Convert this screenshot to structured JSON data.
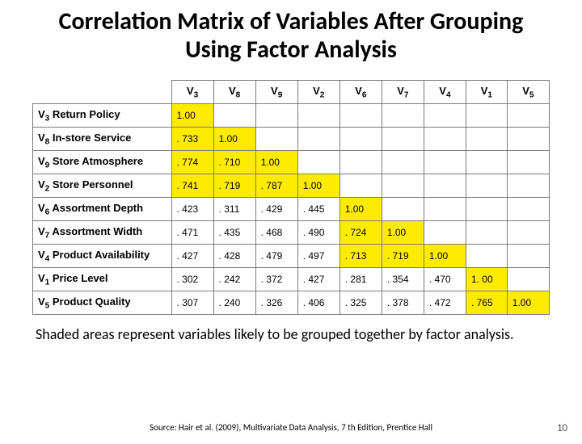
{
  "title": "Correlation Matrix of Variables After Grouping Using Factor Analysis",
  "columns": [
    {
      "sym": "V",
      "sub": "3"
    },
    {
      "sym": "V",
      "sub": "8"
    },
    {
      "sym": "V",
      "sub": "9"
    },
    {
      "sym": "V",
      "sub": "2"
    },
    {
      "sym": "V",
      "sub": "6"
    },
    {
      "sym": "V",
      "sub": "7"
    },
    {
      "sym": "V",
      "sub": "4"
    },
    {
      "sym": "V",
      "sub": "1"
    },
    {
      "sym": "V",
      "sub": "5"
    }
  ],
  "rows": [
    {
      "sym": "V",
      "sub": "3",
      "name": "Return Policy"
    },
    {
      "sym": "V",
      "sub": "8",
      "name": "In-store Service"
    },
    {
      "sym": "V",
      "sub": "9",
      "name": "Store Atmosphere"
    },
    {
      "sym": "V",
      "sub": "2",
      "name": "Store Personnel"
    },
    {
      "sym": "V",
      "sub": "6",
      "name": "Assortment Depth"
    },
    {
      "sym": "V",
      "sub": "7",
      "name": "Assortment Width"
    },
    {
      "sym": "V",
      "sub": "4",
      "name": "Product Availability"
    },
    {
      "sym": "V",
      "sub": "1",
      "name": "Price Level"
    },
    {
      "sym": "V",
      "sub": "5",
      "name": "Product Quality"
    }
  ],
  "cells": [
    [
      "1.00",
      "",
      "",
      "",
      "",
      "",
      "",
      "",
      ""
    ],
    [
      ". 733",
      "1.00",
      "",
      "",
      "",
      "",
      "",
      "",
      ""
    ],
    [
      ". 774",
      ". 710",
      "1.00",
      "",
      "",
      "",
      "",
      "",
      ""
    ],
    [
      ". 741",
      ". 719",
      ". 787",
      "1.00",
      "",
      "",
      "",
      "",
      ""
    ],
    [
      ". 423",
      ". 311",
      ". 429",
      ". 445",
      "1.00",
      "",
      "",
      "",
      ""
    ],
    [
      ". 471",
      ". 435",
      ". 468",
      ". 490",
      ". 724",
      "1.00",
      "",
      "",
      ""
    ],
    [
      ". 427",
      ". 428",
      ". 479",
      ". 497",
      ". 713",
      ". 719",
      "1.00",
      "",
      ""
    ],
    [
      ". 302",
      ". 242",
      ". 372",
      ". 427",
      ". 281",
      ". 354",
      ". 470",
      "1. 00",
      ""
    ],
    [
      ". 307",
      ". 240",
      ". 326",
      ". 406",
      ". 325",
      ". 378",
      ". 472",
      ". 765",
      "1.00"
    ]
  ],
  "highlight": [
    [
      true,
      false,
      false,
      false,
      false,
      false,
      false,
      false,
      false
    ],
    [
      true,
      true,
      false,
      false,
      false,
      false,
      false,
      false,
      false
    ],
    [
      true,
      true,
      true,
      false,
      false,
      false,
      false,
      false,
      false
    ],
    [
      true,
      true,
      true,
      true,
      false,
      false,
      false,
      false,
      false
    ],
    [
      false,
      false,
      false,
      false,
      true,
      false,
      false,
      false,
      false
    ],
    [
      false,
      false,
      false,
      false,
      true,
      true,
      false,
      false,
      false
    ],
    [
      false,
      false,
      false,
      false,
      true,
      true,
      true,
      false,
      false
    ],
    [
      false,
      false,
      false,
      false,
      false,
      false,
      false,
      true,
      false
    ],
    [
      false,
      false,
      false,
      false,
      false,
      false,
      false,
      true,
      true
    ]
  ],
  "caption": "Shaded areas represent variables likely to be grouped together by factor analysis.",
  "source": "Source: Hair et al. (2009), Multivariate Data Analysis, 7 th Edition, Prentice Hall",
  "page_number": "10",
  "chart_data": {
    "type": "table",
    "title": "Correlation Matrix of Variables After Grouping Using Factor Analysis",
    "variables": [
      "V3",
      "V8",
      "V9",
      "V2",
      "V6",
      "V7",
      "V4",
      "V1",
      "V5"
    ],
    "variable_names": {
      "V3": "Return Policy",
      "V8": "In-store Service",
      "V9": "Store Atmosphere",
      "V2": "Store Personnel",
      "V6": "Assortment Depth",
      "V7": "Assortment Width",
      "V4": "Product Availability",
      "V1": "Price Level",
      "V5": "Product Quality"
    },
    "lower_triangular_matrix": [
      [
        1.0
      ],
      [
        0.733,
        1.0
      ],
      [
        0.774,
        0.71,
        1.0
      ],
      [
        0.741,
        0.719,
        0.787,
        1.0
      ],
      [
        0.423,
        0.311,
        0.429,
        0.445,
        1.0
      ],
      [
        0.471,
        0.435,
        0.468,
        0.49,
        0.724,
        1.0
      ],
      [
        0.427,
        0.428,
        0.479,
        0.497,
        0.713,
        0.719,
        1.0
      ],
      [
        0.302,
        0.242,
        0.372,
        0.427,
        0.281,
        0.354,
        0.47,
        1.0
      ],
      [
        0.307,
        0.24,
        0.326,
        0.406,
        0.325,
        0.378,
        0.472,
        0.765,
        1.0
      ]
    ],
    "groups": [
      [
        "V3",
        "V8",
        "V9",
        "V2"
      ],
      [
        "V6",
        "V7",
        "V4"
      ],
      [
        "V1",
        "V5"
      ]
    ],
    "highlight_color": "#ffeb00"
  }
}
